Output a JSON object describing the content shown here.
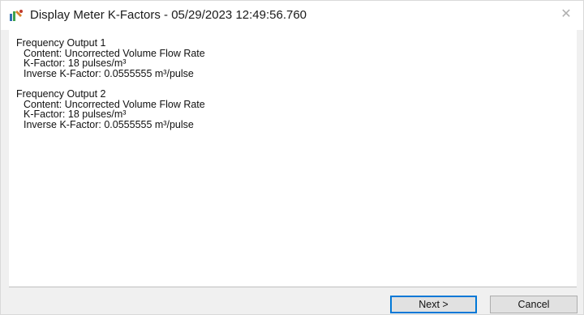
{
  "window": {
    "title": "Display Meter K-Factors - 05/29/2023 12:49:56.760",
    "close_glyph": "✕",
    "app_icon": "wizard-icon"
  },
  "outputs": [
    {
      "heading": "Frequency Output 1",
      "content": "Content: Uncorrected Volume Flow Rate",
      "k_factor": "K-Factor: 18 pulses/m³",
      "inverse_k_factor": "Inverse K-Factor: 0.0555555 m³/pulse"
    },
    {
      "heading": "Frequency Output 2",
      "content": "Content: Uncorrected Volume Flow Rate",
      "k_factor": "K-Factor: 18 pulses/m³",
      "inverse_k_factor": "Inverse K-Factor: 0.0555555 m³/pulse"
    }
  ],
  "buttons": {
    "next_label": "Next >",
    "cancel_label": "Cancel"
  },
  "colors": {
    "accent": "#0078d7",
    "panel_background": "#ffffff",
    "window_background": "#f0f0f0"
  }
}
